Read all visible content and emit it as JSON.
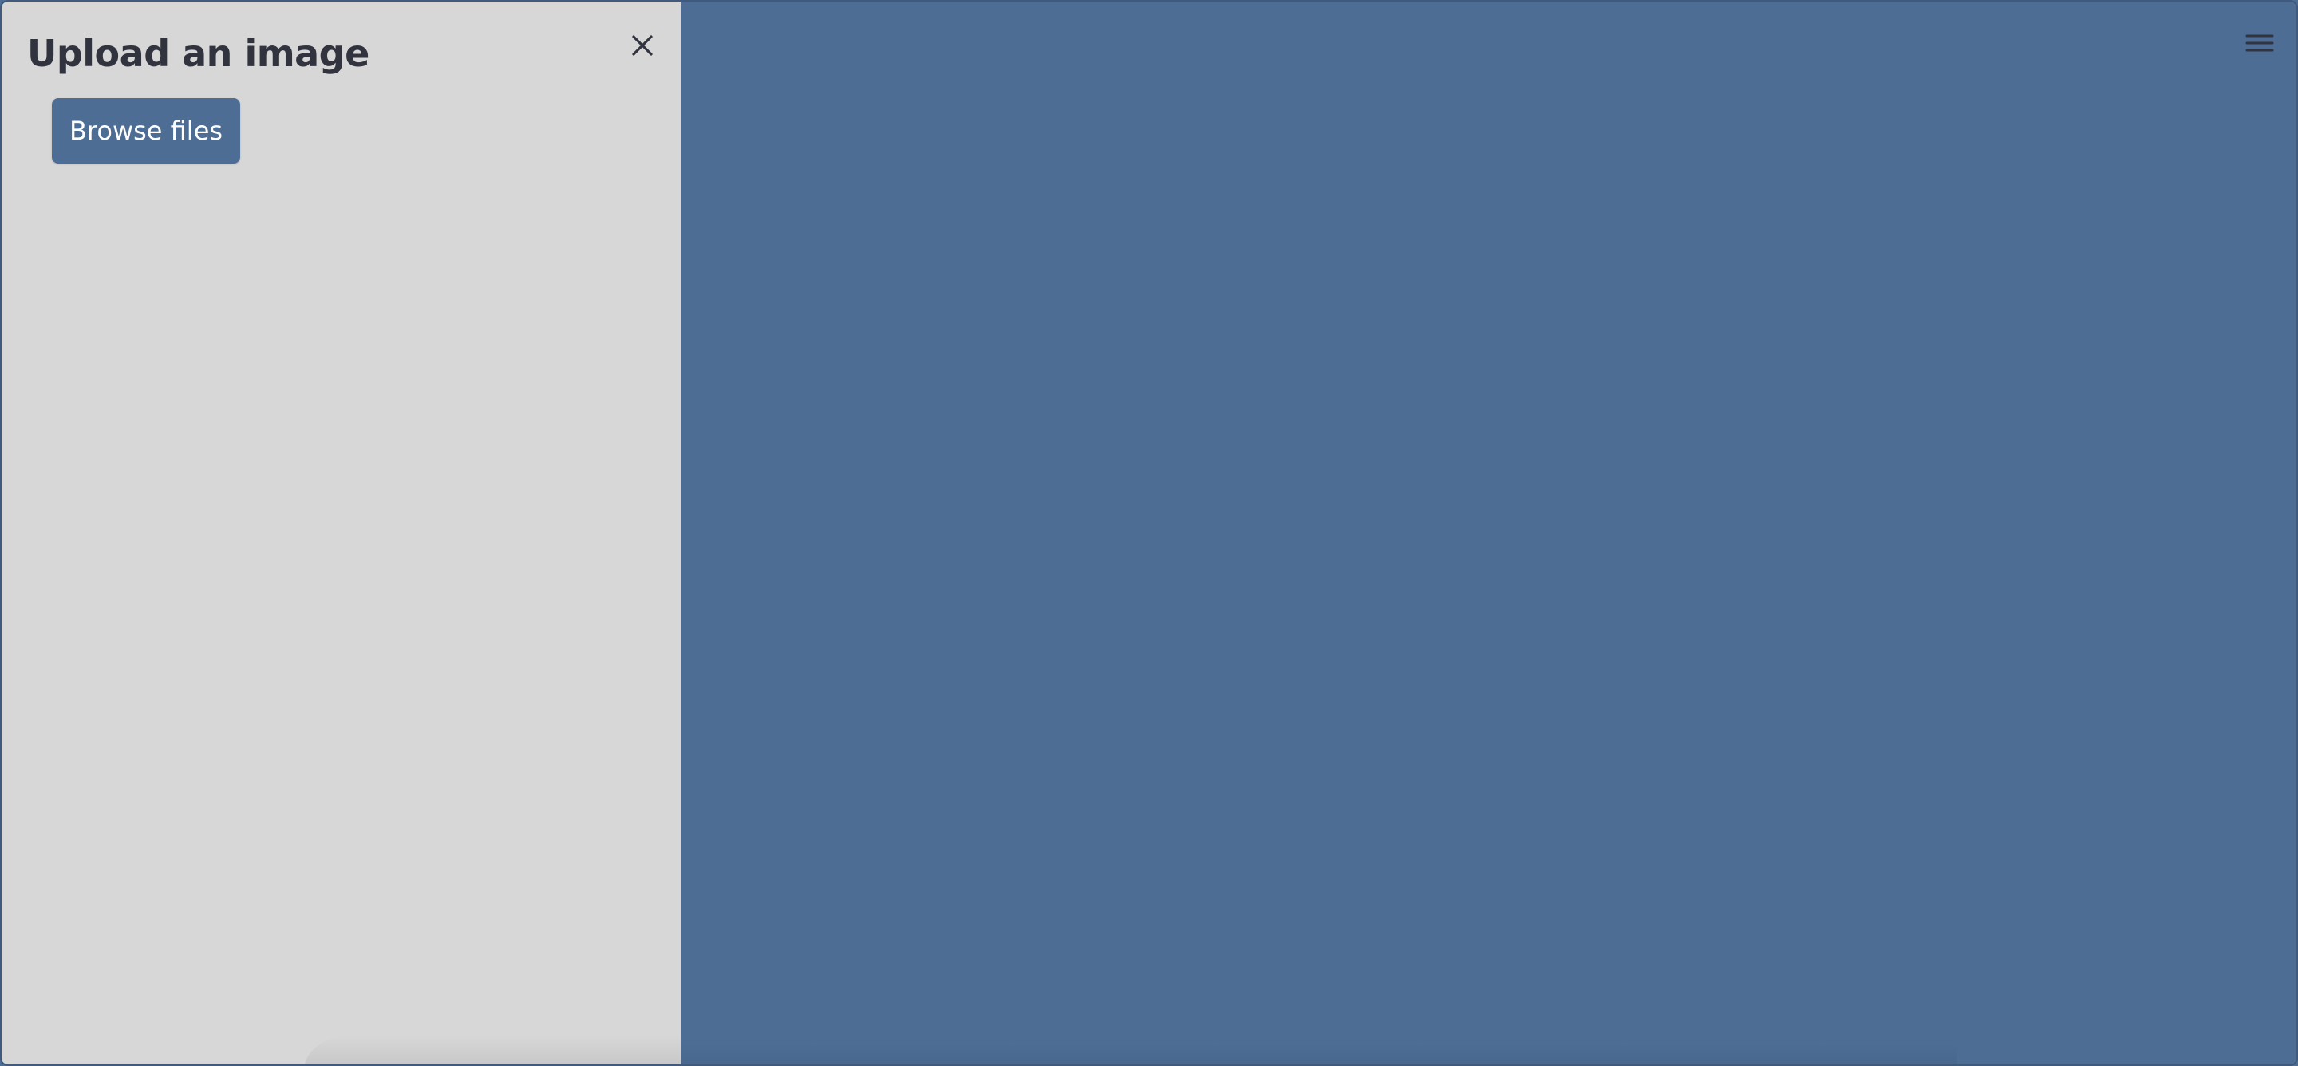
{
  "sidebar": {
    "title": "Upload an image",
    "close_icon": "close-icon",
    "browse_button_label": "Browse files"
  },
  "main": {
    "menu_icon": "hamburger-menu-icon"
  },
  "colors": {
    "sidebar_background": "#d7d7d7",
    "main_background": "#4d6d95",
    "button_background": "#4d6d95",
    "button_text": "#ffffff",
    "title_text": "#31333f",
    "icon_color": "#31333f"
  }
}
